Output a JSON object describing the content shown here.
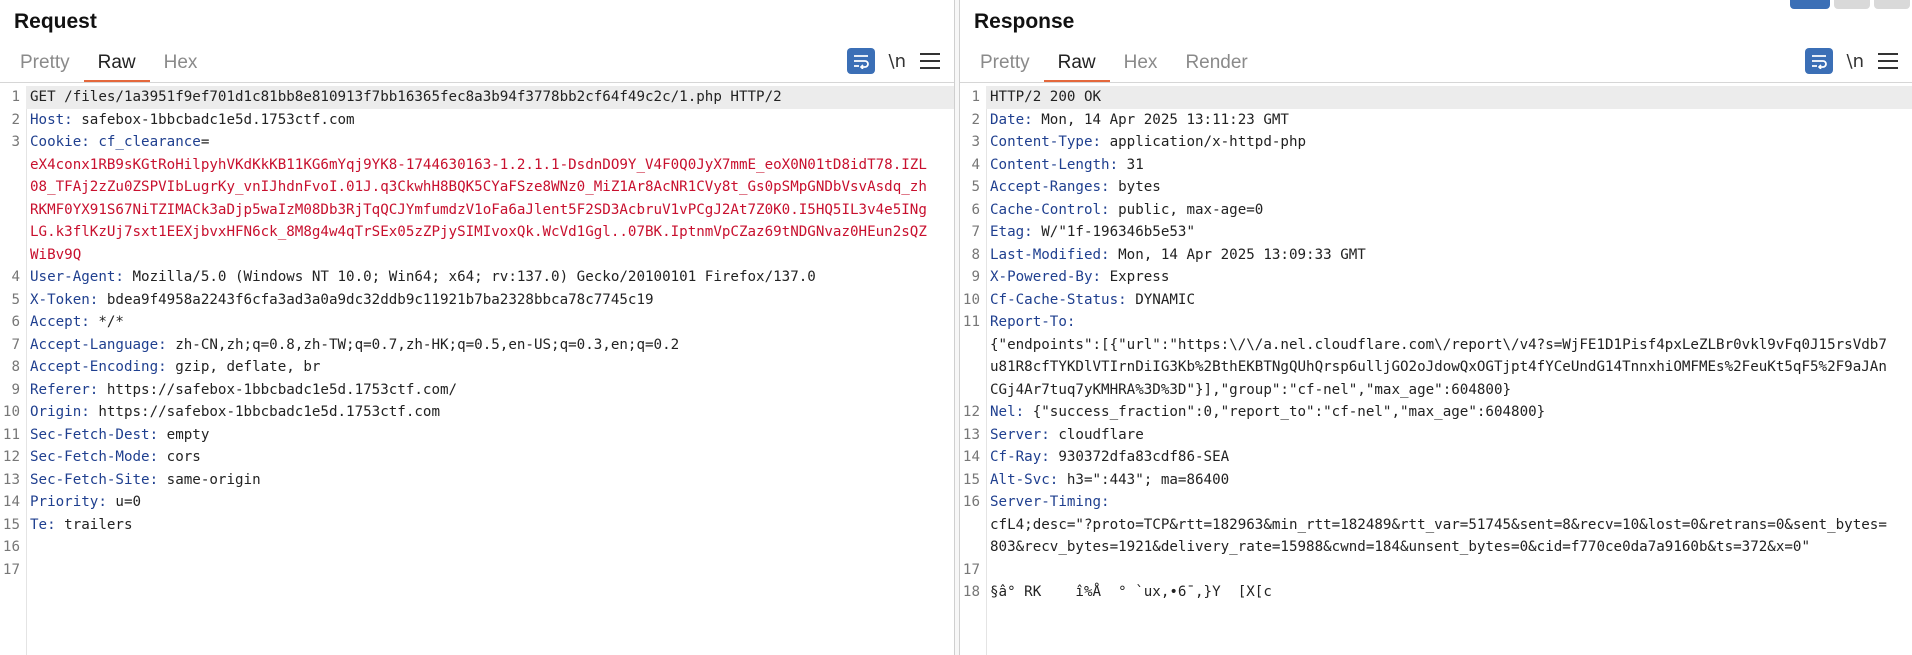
{
  "request": {
    "title": "Request",
    "tabs": [
      "Pretty",
      "Raw",
      "Hex"
    ],
    "active_tab": "Raw",
    "lines": [
      {
        "n": "1",
        "text": "GET /files/1a3951f9ef701d1c81bb8e810913f7bb16365fec8a3b94f3778bb2cf64f49c2c/1.php HTTP/2"
      },
      {
        "n": "2",
        "key": "Host:",
        "value": " safebox-1bbcbadc1e5d.1753ctf.com"
      },
      {
        "n": "3",
        "key": "Cookie:",
        "cookie_name": " cf_clearance",
        "cookie_eq": "=",
        "cookie_value": "eX4conx1RB9sKGtRoHilpyhVKdKkKB11KG6mYqj9YK8-1744630163-1.2.1.1-DsdnDO9Y_V4F0Q0JyX7mmE_eoX0N01tD8idT78.IZL08_TFAj2zZu0ZSPVIbLugrKy_vnIJhdnFvoI.01J.q3CkwhH8BQK5CYaFSze8WNz0_MiZ1Ar8AcNR1CVy8t_Gs0pSMpGNDbVsvAsdq_zhRKMF0YX91S67NiTZIMACk3aDjp5waIzM08Db3RjTqQCJYmfumdzV1oFa6aJlent5F2SD3AcbruV1vPCgJ2At7Z0K0.I5HQ5IL3v4e5INgLG.k3flKzUj7sxt1EEXjbvxHFN6ck_8M8g4w4qTrSEx05zZPjySIMIvoxQk.WcVd1Ggl..07BK.IptnmVpCZaz69tNDGNvaz0HEun2sQZWiBv9Q"
      },
      {
        "n": "4",
        "key": "User-Agent:",
        "value": " Mozilla/5.0 (Windows NT 10.0; Win64; x64; rv:137.0) Gecko/20100101 Firefox/137.0"
      },
      {
        "n": "5",
        "key": "X-Token:",
        "value": " bdea9f4958a2243f6cfa3ad3a0a9dc32ddb9c11921b7ba2328bbca78c7745c19"
      },
      {
        "n": "6",
        "key": "Accept:",
        "value": " */*"
      },
      {
        "n": "7",
        "key": "Accept-Language:",
        "value": " zh-CN,zh;q=0.8,zh-TW;q=0.7,zh-HK;q=0.5,en-US;q=0.3,en;q=0.2"
      },
      {
        "n": "8",
        "key": "Accept-Encoding:",
        "value": " gzip, deflate, br"
      },
      {
        "n": "9",
        "key": "Referer:",
        "value": " https://safebox-1bbcbadc1e5d.1753ctf.com/"
      },
      {
        "n": "10",
        "key": "Origin:",
        "value": " https://safebox-1bbcbadc1e5d.1753ctf.com"
      },
      {
        "n": "11",
        "key": "Sec-Fetch-Dest:",
        "value": " empty"
      },
      {
        "n": "12",
        "key": "Sec-Fetch-Mode:",
        "value": " cors"
      },
      {
        "n": "13",
        "key": "Sec-Fetch-Site:",
        "value": " same-origin"
      },
      {
        "n": "14",
        "key": "Priority:",
        "value": " u=0"
      },
      {
        "n": "15",
        "key": "Te:",
        "value": " trailers"
      },
      {
        "n": "16",
        "text": ""
      },
      {
        "n": "17",
        "text": ""
      }
    ]
  },
  "response": {
    "title": "Response",
    "tabs": [
      "Pretty",
      "Raw",
      "Hex",
      "Render"
    ],
    "active_tab": "Raw",
    "lines": [
      {
        "n": "1",
        "text": "HTTP/2 200 OK"
      },
      {
        "n": "2",
        "key": "Date:",
        "value": " Mon, 14 Apr 2025 13:11:23 GMT"
      },
      {
        "n": "3",
        "key": "Content-Type:",
        "value": " application/x-httpd-php"
      },
      {
        "n": "4",
        "key": "Content-Length:",
        "value": " 31"
      },
      {
        "n": "5",
        "key": "Accept-Ranges:",
        "value": " bytes"
      },
      {
        "n": "6",
        "key": "Cache-Control:",
        "value": " public, max-age=0"
      },
      {
        "n": "7",
        "key": "Etag:",
        "value": " W/\"1f-196346b5e53\""
      },
      {
        "n": "8",
        "key": "Last-Modified:",
        "value": " Mon, 14 Apr 2025 13:09:33 GMT"
      },
      {
        "n": "9",
        "key": "X-Powered-By:",
        "value": " Express"
      },
      {
        "n": "10",
        "key": "Cf-Cache-Status:",
        "value": " DYNAMIC"
      },
      {
        "n": "11",
        "key": "Report-To:",
        "value": "\n{\"endpoints\":[{\"url\":\"https:\\/\\/a.nel.cloudflare.com\\/report\\/v4?s=WjFE1D1Pisf4pxLeZLBr0vkl9vFq0J15rsVdb7u81R8cfTYKDlVTIrnDiIG3Kb%2BthEKBTNgQUhQrsp6ulljGO2oJdowQxOGTjpt4fYCeUndG14TnnxhiOMFMEs%2FeuKt5qF5%2F9aJAnCGj4Ar7tuq7yKMHRA%3D%3D\"}],\"group\":\"cf-nel\",\"max_age\":604800}"
      },
      {
        "n": "12",
        "key": "Nel:",
        "value": " {\"success_fraction\":0,\"report_to\":\"cf-nel\",\"max_age\":604800}"
      },
      {
        "n": "13",
        "key": "Server:",
        "value": " cloudflare"
      },
      {
        "n": "14",
        "key": "Cf-Ray:",
        "value": " 930372dfa83cdf86-SEA"
      },
      {
        "n": "15",
        "key": "Alt-Svc:",
        "value": " h3=\":443\"; ma=86400"
      },
      {
        "n": "16",
        "key": "Server-Timing:",
        "value": "\ncfL4;desc=\"?proto=TCP&rtt=182963&min_rtt=182489&rtt_var=51745&sent=8&recv=10&lost=0&retrans=0&sent_bytes=803&recv_bytes=1921&delivery_rate=15988&cwnd=184&unsent_bytes=0&cid=f770ce0da7a9160b&ts=372&x=0\""
      },
      {
        "n": "17",
        "text": ""
      },
      {
        "n": "18",
        "text": "§â° RK    î%Å  ° `ux,•6¯,}Y  [X[c"
      }
    ]
  },
  "colors": {
    "accent": "#e4683c",
    "header_key": "#1f3f8f",
    "cookie_value": "#c8102e",
    "wrap_button": "#3b6fb6"
  },
  "icons": {
    "wrap": "wrap-lines-icon",
    "newline": "\\n",
    "menu": "hamburger-menu-icon"
  }
}
